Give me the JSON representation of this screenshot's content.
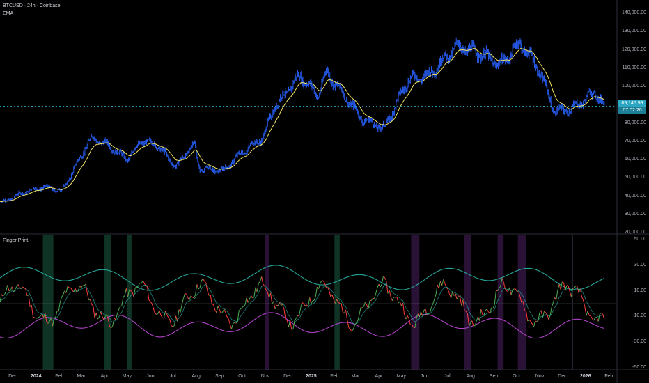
{
  "chart_info": {
    "symbol_line": "BTCUSD · 24h · Coinbase",
    "indicator_ema": "EMA",
    "indicator_oscillator": "Finger Print."
  },
  "price_axis": {
    "ticks": [
      "140,000.00",
      "130,000.00",
      "120,000.00",
      "110,000.00",
      "100,000.00",
      "90,000.00",
      "80,000.00",
      "70,000.00",
      "60,000.00",
      "50,000.00",
      "40,000.00",
      "30,000.00",
      "20,000.00"
    ],
    "values": [
      140000,
      130000,
      120000,
      110000,
      100000,
      90000,
      80000,
      70000,
      60000,
      50000,
      40000,
      30000,
      20000
    ],
    "last_price": "89,145.99",
    "countdown": "07:02:20"
  },
  "osc_axis": {
    "ticks": [
      "50.00",
      "30.00",
      "10.00",
      "-10.00",
      "-30.00",
      "-50.00"
    ],
    "values": [
      50,
      30,
      10,
      -10,
      -30,
      -50
    ]
  },
  "time_axis": {
    "labels": [
      {
        "text": "Dec",
        "year": false
      },
      {
        "text": "2024",
        "year": true
      },
      {
        "text": "Feb",
        "year": false
      },
      {
        "text": "Mar",
        "year": false
      },
      {
        "text": "Apr",
        "year": false
      },
      {
        "text": "May",
        "year": false
      },
      {
        "text": "Jun",
        "year": false
      },
      {
        "text": "Jul",
        "year": false
      },
      {
        "text": "Aug",
        "year": false
      },
      {
        "text": "Sep",
        "year": false
      },
      {
        "text": "Oct",
        "year": false
      },
      {
        "text": "Nov",
        "year": false
      },
      {
        "text": "Dec",
        "year": false
      },
      {
        "text": "2025",
        "year": true
      },
      {
        "text": "Feb",
        "year": false
      },
      {
        "text": "Mar",
        "year": false
      },
      {
        "text": "Apr",
        "year": false
      },
      {
        "text": "May",
        "year": false
      },
      {
        "text": "Jun",
        "year": false
      },
      {
        "text": "Jul",
        "year": false
      },
      {
        "text": "Aug",
        "year": false
      },
      {
        "text": "Sep",
        "year": false
      },
      {
        "text": "Oct",
        "year": false
      },
      {
        "text": "Nov",
        "year": false
      },
      {
        "text": "Dec",
        "year": false
      },
      {
        "text": "2026",
        "year": true
      },
      {
        "text": "Feb",
        "year": false
      }
    ]
  },
  "colors": {
    "background": "#000000",
    "candles": "#2962ff",
    "ema": "#f5e663",
    "price_tag": "#2aa6c2",
    "osc_upper": "#26a69a",
    "osc_lower": "#b042c8",
    "osc_up": "#4caf50",
    "osc_down": "#ff3b3b",
    "band_green": "#0f3324",
    "band_purple": "#2a1236"
  },
  "chart_data": {
    "type": "line",
    "series": [
      {
        "x": [
          "2023-11-20",
          "2023-12-15",
          "2024-01-10",
          "2024-02-05",
          "2024-03-01",
          "2024-03-14",
          "2024-04-05",
          "2024-05-01",
          "2024-05-20",
          "2024-06-10",
          "2024-07-05",
          "2024-07-29",
          "2024-08-05",
          "2024-09-06",
          "2024-10-01",
          "2024-10-29",
          "2024-11-12",
          "2024-12-05",
          "2024-12-17",
          "2025-01-10",
          "2025-01-21",
          "2025-02-10",
          "2025-03-10",
          "2025-04-08",
          "2025-05-10",
          "2025-06-05",
          "2025-07-14",
          "2025-08-14",
          "2025-09-10",
          "2025-10-06",
          "2025-10-30",
          "2025-11-21",
          "2025-12-15",
          "2026-01-14",
          "2026-01-26"
        ],
        "values": [
          37000,
          42000,
          45000,
          43000,
          62000,
          72000,
          68000,
          60000,
          70000,
          68000,
          56000,
          69000,
          55000,
          54000,
          64000,
          72000,
          88000,
          100000,
          106000,
          95000,
          108000,
          97000,
          82000,
          77000,
          104000,
          106000,
          122000,
          118000,
          112000,
          124000,
          110000,
          86000,
          88000,
          97000,
          89146
        ]
      }
    ],
    "ylim": [
      20000,
      145000
    ],
    "highlighted_periods": [
      {
        "start": "2024-01-10",
        "end": "2024-01-24",
        "tone": "green"
      },
      {
        "start": "2024-04-01",
        "end": "2024-04-10",
        "tone": "green"
      },
      {
        "start": "2024-05-01",
        "end": "2024-05-07",
        "tone": "green"
      },
      {
        "start": "2024-11-01",
        "end": "2024-11-06",
        "tone": "purple"
      },
      {
        "start": "2025-02-01",
        "end": "2025-02-08",
        "tone": "green"
      },
      {
        "start": "2025-05-14",
        "end": "2025-05-25",
        "tone": "purple"
      },
      {
        "start": "2025-07-23",
        "end": "2025-08-02",
        "tone": "purple"
      },
      {
        "start": "2025-09-06",
        "end": "2025-09-14",
        "tone": "purple"
      },
      {
        "start": "2025-10-03",
        "end": "2025-10-14",
        "tone": "purple"
      }
    ],
    "oscillator_ylim": [
      -50,
      50
    ]
  }
}
